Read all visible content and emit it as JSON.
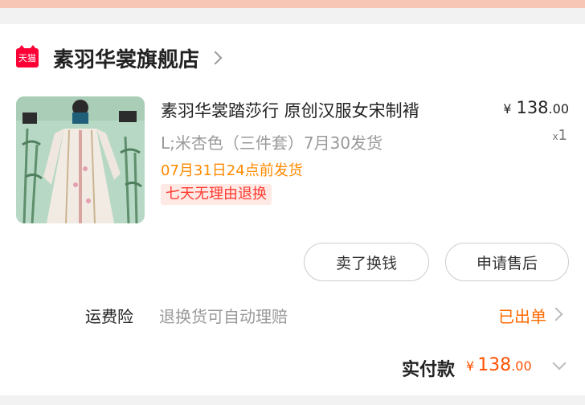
{
  "store": {
    "logo_text": "天猫",
    "name": "素羽华裳旗舰店"
  },
  "product": {
    "title": "素羽华裳踏莎行 原创汉服女宋制褙",
    "price_currency": "¥",
    "price_main": "138",
    "price_cents": ".00",
    "qty_prefix": "x",
    "qty": "1",
    "spec": "L;米杏色（三件套）7月30发货",
    "ship_time": "07月31日24点前发货",
    "return_badge": "七天无理由退换"
  },
  "actions": {
    "sell_label": "卖了换钱",
    "aftersale_label": "申请售后"
  },
  "insurance": {
    "label": "运费险",
    "description": "退换货可自动理赔",
    "status": "已出单"
  },
  "total": {
    "label": "实付款",
    "currency": "¥",
    "amount_main": "138",
    "amount_cents": ".00"
  },
  "colors": {
    "accent_orange": "#ff5000",
    "tmall_red": "#ff0036",
    "ship_orange": "#ff8a00"
  }
}
